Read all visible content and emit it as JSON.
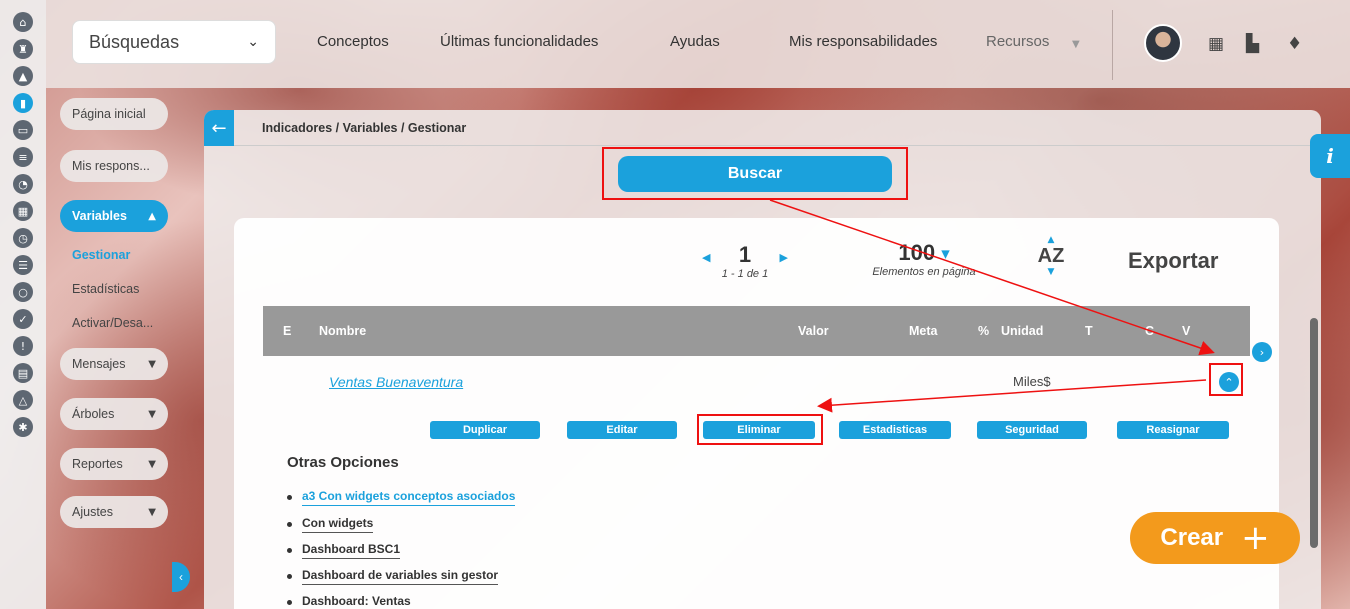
{
  "rail": {
    "icons": [
      "home-icon",
      "chess-rook-icon",
      "triangle-up-icon",
      "bar-chart-icon",
      "presentation-icon",
      "align-icon",
      "pie-chart-icon",
      "map-icon",
      "clock-icon",
      "list-icon",
      "cycle-icon",
      "check-circle-icon",
      "warning-icon",
      "calendar-icon",
      "network-icon",
      "gear-icon"
    ]
  },
  "topbar": {
    "search_label": "Búsquedas",
    "nav": {
      "conceptos": "Conceptos",
      "ultimas": "Últimas funcionalidades",
      "ayudas": "Ayudas",
      "responsabilidades": "Mis responsabilidades",
      "recursos": "Recursos"
    }
  },
  "sidebar": {
    "pagina_inicial": "Página inicial",
    "mis_respons": "Mis respons...",
    "variables": "Variables",
    "gestionar": "Gestionar",
    "estadisticas": "Estadísticas",
    "activar": "Activar/Desa...",
    "mensajes": "Mensajes",
    "arboles": "Árboles",
    "reportes": "Reportes",
    "ajustes": "Ajustes"
  },
  "main": {
    "breadcrumb": "Indicadores / Variables / Gestionar",
    "search_button": "Buscar",
    "pager": {
      "page": "1",
      "range": "1 - 1 de 1"
    },
    "per_page": {
      "value": "100",
      "label": "Elementos en página"
    },
    "sort_label": "AZ",
    "export_label": "Exportar",
    "columns": {
      "e": "E",
      "nombre": "Nombre",
      "valor": "Valor",
      "meta": "Meta",
      "pct": "%",
      "unidad": "Unidad",
      "t": "T",
      "c": "C",
      "v": "V"
    },
    "row": {
      "name": "Ventas Buenaventura",
      "unit": "Miles$"
    },
    "actions": {
      "duplicar": "Duplicar",
      "editar": "Editar",
      "eliminar": "Eliminar",
      "estadisticas": "Estadisticas",
      "seguridad": "Seguridad",
      "reasignar": "Reasignar"
    },
    "other_title": "Otras Opciones",
    "other_options": [
      "a3 Con widgets conceptos asociados",
      "Con widgets",
      "Dashboard BSC1",
      "Dashboard de variables sin gestor",
      "Dashboard: Ventas"
    ]
  },
  "create_label": "Crear",
  "colors": {
    "accent": "#1ba1dc",
    "create": "#f39a1c",
    "highlight": "#e11111"
  }
}
